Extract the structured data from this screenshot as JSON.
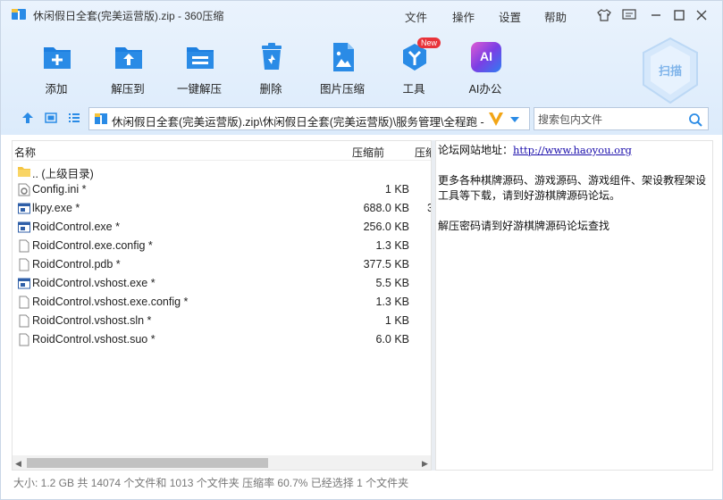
{
  "window": {
    "title": "休闲假日全套(完美运营版).zip - 360压缩",
    "menus": [
      "文件",
      "操作",
      "设置",
      "帮助"
    ]
  },
  "toolbar": {
    "items": [
      {
        "label": "添加",
        "icon": "add-icon"
      },
      {
        "label": "解压到",
        "icon": "extract-to-icon"
      },
      {
        "label": "一键解压",
        "icon": "one-click-extract-icon"
      },
      {
        "label": "删除",
        "icon": "delete-icon"
      },
      {
        "label": "图片压缩",
        "icon": "image-compress-icon"
      },
      {
        "label": "工具",
        "icon": "tools-icon",
        "badge": "New"
      },
      {
        "label": "AI办公",
        "icon": "ai-office-icon",
        "icon_text": "AI"
      }
    ],
    "scan_label": "扫描"
  },
  "address": {
    "path": "休闲假日全套(完美运营版).zip\\休闲假日全套(完美运营版)\\服务管理\\全程跑 - 解",
    "search_placeholder": "搜索包内文件"
  },
  "file_list": {
    "headers": {
      "name": "名称",
      "size_before": "压缩前",
      "size_after": "压缩"
    },
    "rows": [
      {
        "name": ".. (上级目录)",
        "size": "",
        "type": "folder"
      },
      {
        "name": "Config.ini *",
        "size": "1 KB",
        "type": "ini"
      },
      {
        "name": "lkpy.exe *",
        "size": "688.0 KB",
        "type": "exe",
        "extra": "3"
      },
      {
        "name": "RoidControl.exe *",
        "size": "256.0 KB",
        "type": "exe"
      },
      {
        "name": "RoidControl.exe.config *",
        "size": "1.3 KB",
        "type": "file"
      },
      {
        "name": "RoidControl.pdb *",
        "size": "377.5 KB",
        "type": "file"
      },
      {
        "name": "RoidControl.vshost.exe *",
        "size": "5.5 KB",
        "type": "exe"
      },
      {
        "name": "RoidControl.vshost.exe.config *",
        "size": "1.3 KB",
        "type": "file"
      },
      {
        "name": "RoidControl.vshost.sln *",
        "size": "1 KB",
        "type": "file"
      },
      {
        "name": "RoidControl.vshost.suo *",
        "size": "6.0 KB",
        "type": "file"
      }
    ]
  },
  "comment": {
    "line1_label": "论坛网站地址：",
    "line1_link": "http://www.haoyou.org",
    "line2": "更多各种棋牌源码、游戏源码、游戏组件、架设教程架设工具等下载，请到好游棋牌源码论坛。",
    "line3": "解压密码请到好游棋牌源码论坛查找"
  },
  "status": {
    "text": "大小: 1.2 GB 共 14074 个文件和 1013 个文件夹 压缩率 60.7% 已经选择 1 个文件夹"
  },
  "colors": {
    "accent_blue": "#2a8be6",
    "top_bg": "#e4effc",
    "badge_red": "#e8333a",
    "ai_purple": "#7b3fe4"
  }
}
